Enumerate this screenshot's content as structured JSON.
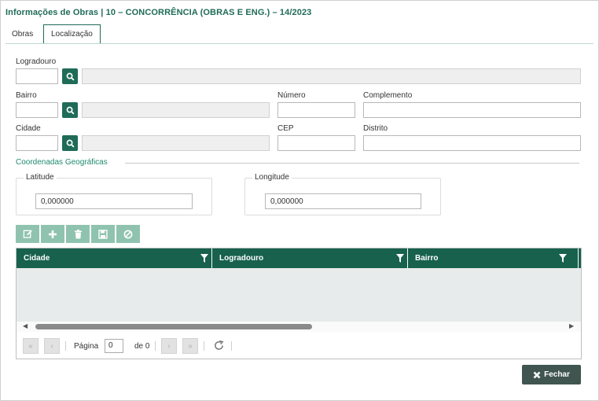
{
  "window": {
    "title": "Informações de Obras | 10 – CONCORRÊNCIA (OBRAS E ENG.) – 14/2023"
  },
  "tabs": [
    {
      "label": "Obras"
    },
    {
      "label": "Localização"
    }
  ],
  "form": {
    "logradouro": {
      "label": "Logradouro",
      "code": "",
      "desc": ""
    },
    "bairro": {
      "label": "Bairro",
      "code": "",
      "desc": ""
    },
    "cidade": {
      "label": "Cidade",
      "code": "",
      "desc": ""
    },
    "numero": {
      "label": "Número",
      "value": ""
    },
    "complemento": {
      "label": "Complemento",
      "value": ""
    },
    "cep": {
      "label": "CEP",
      "value": ""
    },
    "distrito": {
      "label": "Distrito",
      "value": ""
    }
  },
  "coords": {
    "section_title": "Coordenadas Geográficas",
    "latitude": {
      "label": "Latitude",
      "value": "0,000000"
    },
    "longitude": {
      "label": "Longitude",
      "value": "0,000000"
    }
  },
  "toolbar": {
    "icons": [
      "edit-icon",
      "plus-icon",
      "trash-icon",
      "save-icon",
      "cancel-icon"
    ]
  },
  "grid": {
    "columns": [
      {
        "label": "Cidade"
      },
      {
        "label": "Logradouro"
      },
      {
        "label": "Bairro"
      }
    ],
    "rows": []
  },
  "pager": {
    "page_label": "Página",
    "page_value": "0",
    "of_label": "de 0"
  },
  "footer": {
    "close_label": "Fechar"
  },
  "colors": {
    "primary": "#1f6b57",
    "header": "#17614d",
    "toolbar": "#8fc3b0",
    "close_button": "#40554f"
  }
}
